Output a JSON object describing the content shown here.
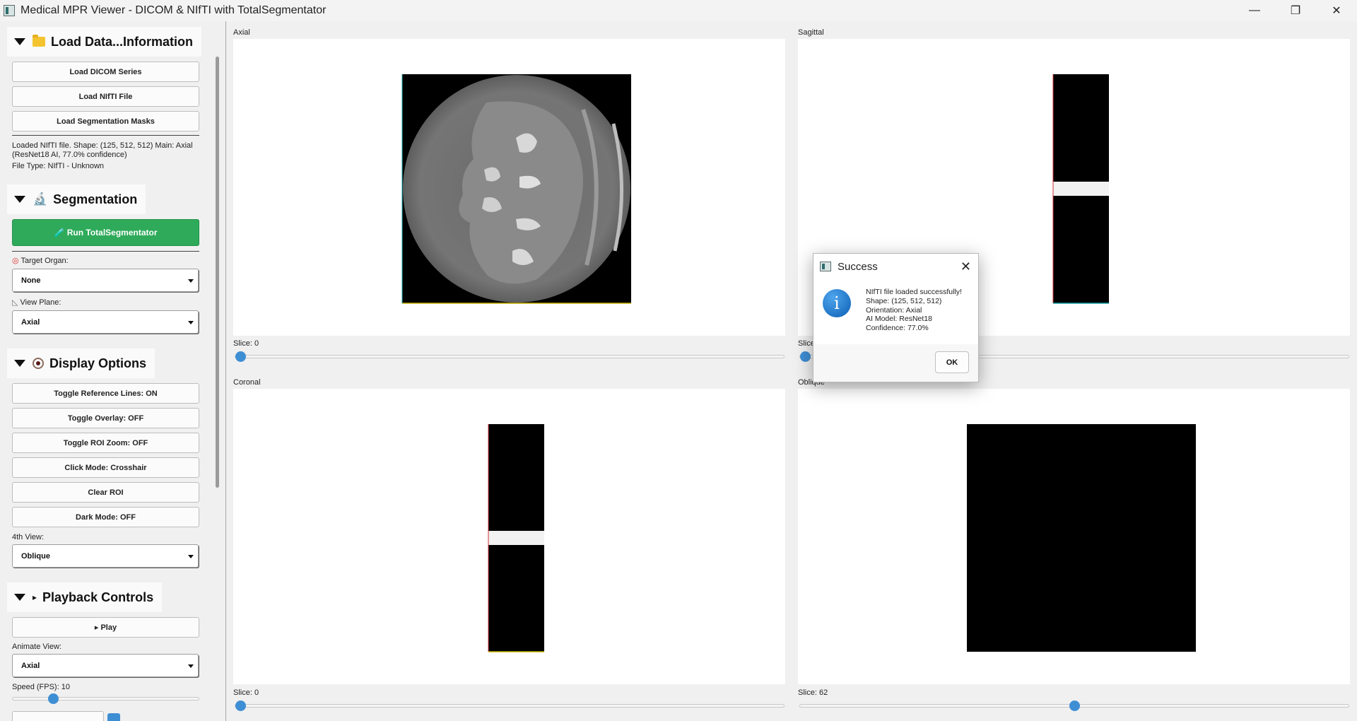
{
  "window": {
    "title": "Medical MPR Viewer - DICOM & NIfTI with TotalSegmentator",
    "minimize": "—",
    "maximize": "❐",
    "close": "✕"
  },
  "sidebar": {
    "load_section": {
      "header": "Load Data...Information",
      "load_dicom": "Load DICOM Series",
      "load_nifti": "Load NIfTI File",
      "load_masks": "Load Segmentation Masks",
      "info_line1": "Loaded NIfTI file. Shape: (125, 512, 512)  Main: Axial",
      "info_line2": "(ResNet18 AI, 77.0% confidence)",
      "file_type": "File Type: NIfTI - Unknown"
    },
    "segmentation_section": {
      "header": "Segmentation",
      "run_button": "🧪 Run TotalSegmentator",
      "target_organ_label": "Target Organ:",
      "target_organ_value": "None",
      "view_plane_label": "View Plane:",
      "view_plane_value": "Axial"
    },
    "display_section": {
      "header": "Display Options",
      "toggle_ref_lines": "Toggle Reference Lines: ON",
      "toggle_overlay": "Toggle Overlay: OFF",
      "toggle_roi_zoom": "Toggle ROI Zoom: OFF",
      "click_mode": "Click Mode: Crosshair",
      "clear_roi": "Clear ROI",
      "dark_mode": "Dark Mode: OFF",
      "fourth_view_label": "4th View:",
      "fourth_view_value": "Oblique"
    },
    "playback_section": {
      "header": "Playback Controls",
      "play_button": "▸ Play",
      "animate_view_label": "Animate View:",
      "animate_view_value": "Axial",
      "speed_label": "Speed (FPS): 10",
      "speed_fraction": 0.2
    }
  },
  "views": {
    "axial": {
      "label": "Axial",
      "slice_text": "Slice: 0",
      "slice_fraction": 0.0
    },
    "sagittal": {
      "label": "Sagittal",
      "slice_text": "Slice: 0",
      "slice_fraction": 0.0
    },
    "coronal": {
      "label": "Coronal",
      "slice_text": "Slice: 0",
      "slice_fraction": 0.0
    },
    "oblique": {
      "label": "Oblique",
      "slice_text": "Slice: 62",
      "slice_fraction": 0.5
    }
  },
  "dialog": {
    "title": "Success",
    "message": "NIfTI file loaded successfully!\nShape: (125, 512, 512)\nOrientation: Axial\nAI Model: ResNet18\nConfidence: 77.0%",
    "ok": "OK",
    "info_glyph": "i",
    "close_glyph": "✕"
  },
  "colors": {
    "run_button": "#2eaa5a",
    "slider_handle": "#3e8ed4"
  }
}
